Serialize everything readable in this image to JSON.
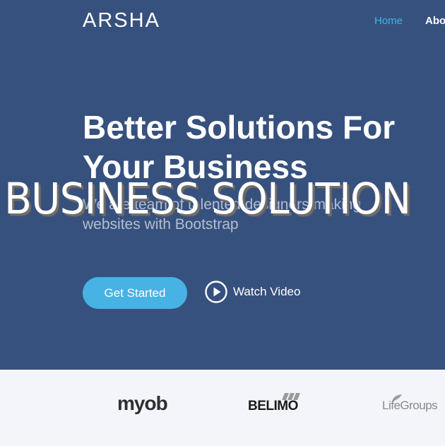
{
  "header": {
    "brand": "ARSHA",
    "nav": [
      {
        "label": "Home",
        "active": true
      },
      {
        "label": "About",
        "active": false
      }
    ]
  },
  "hero": {
    "title": "Better Solutions For Your Business",
    "subtitle": "We are team of talented designers making websites with Bootstrap",
    "cta_label": "Get Started",
    "watch_label": "Watch Video",
    "overlay_text": "BUSINESS SOLUTION"
  },
  "clients": {
    "logos": [
      "myob",
      "BELIMO",
      "LifeGroups"
    ]
  },
  "colors": {
    "hero_bg": "#37517e",
    "accent": "#47b2e4",
    "clients_bg": "#f3f5fa"
  }
}
